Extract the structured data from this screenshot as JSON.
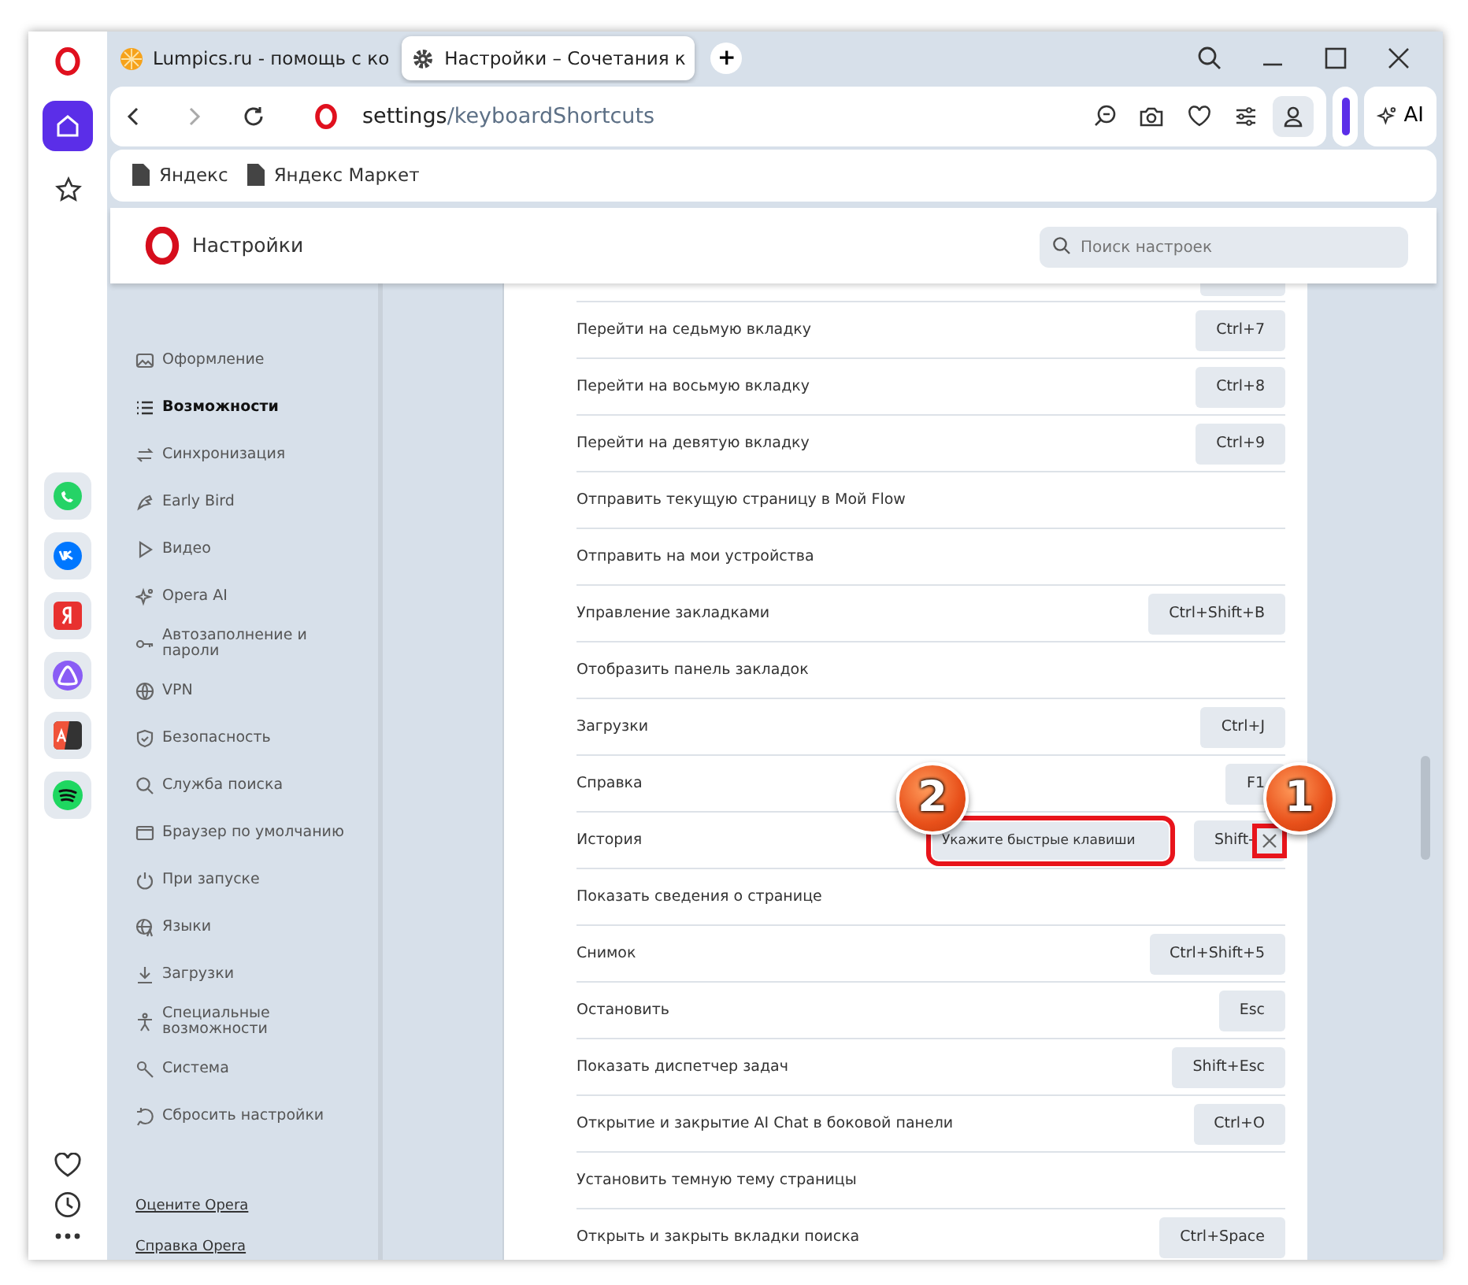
{
  "tabs": [
    {
      "title": "Lumpics.ru - помощь с ко",
      "selected": false
    },
    {
      "title": "Настройки – Сочетания к",
      "selected": true
    }
  ],
  "new_tab": "+",
  "address": {
    "host": "settings",
    "path": "/keyboardShortcuts"
  },
  "ai_button": "AI",
  "bookmarks": [
    "Яндекс",
    "Яндекс Маркет"
  ],
  "settings_header": {
    "title": "Настройки",
    "search_placeholder": "Поиск настроек"
  },
  "nav": {
    "items": [
      {
        "label": "Оформление",
        "selected": false
      },
      {
        "label": "Возможности",
        "selected": true
      },
      {
        "label": "Синхронизация",
        "selected": false
      },
      {
        "label": "Early Bird",
        "selected": false
      },
      {
        "label": "Видео",
        "selected": false
      },
      {
        "label": "Opera AI",
        "selected": false
      },
      {
        "label": "Автозаполнение и пароли",
        "selected": false
      },
      {
        "label": "VPN",
        "selected": false
      },
      {
        "label": "Безопасность",
        "selected": false
      },
      {
        "label": "Служба поиска",
        "selected": false
      },
      {
        "label": "Браузер по умолчанию",
        "selected": false
      },
      {
        "label": "При запуске",
        "selected": false
      },
      {
        "label": "Языки",
        "selected": false
      },
      {
        "label": "Загрузки",
        "selected": false
      },
      {
        "label": "Специальные возможности",
        "selected": false
      },
      {
        "label": "Система",
        "selected": false
      },
      {
        "label": "Сбросить настройки",
        "selected": false
      }
    ],
    "links": [
      "Оцените Opera",
      "Справка Opera"
    ]
  },
  "shortcuts": [
    {
      "action": "Перейти на седьмую вкладку",
      "key": "Ctrl+7"
    },
    {
      "action": "Перейти на восьмую вкладку",
      "key": "Ctrl+8"
    },
    {
      "action": "Перейти на девятую вкладку",
      "key": "Ctrl+9"
    },
    {
      "action": "Отправить текущую страницу в Мой Flow"
    },
    {
      "action": "Отправить на мои устройства"
    },
    {
      "action": "Управление закладками",
      "key": "Ctrl+Shift+B"
    },
    {
      "action": "Отобразить панель закладок"
    },
    {
      "action": "Загрузки",
      "key": "Ctrl+J"
    },
    {
      "action": "Справка",
      "key": "F1"
    },
    {
      "action": "История",
      "kind": "editing",
      "placeholder": "Укажите быстрые клавиши",
      "key": "Shift-",
      "highlighted": true,
      "field_annotation": "2",
      "clear_annotation": "1"
    },
    {
      "action": "Показать сведения о странице"
    },
    {
      "action": "Снимок",
      "key": "Ctrl+Shift+5"
    },
    {
      "action": "Остановить",
      "key": "Esc"
    },
    {
      "action": "Показать диспетчер задач",
      "key": "Shift+Esc"
    },
    {
      "action": "Открытие и закрытие AI Chat в боковой панели",
      "key": "Ctrl+O"
    },
    {
      "action": "Установить темную тему страницы"
    },
    {
      "action": "Открыть и закрыть вкладки поиска",
      "key": "Ctrl+Space"
    }
  ]
}
